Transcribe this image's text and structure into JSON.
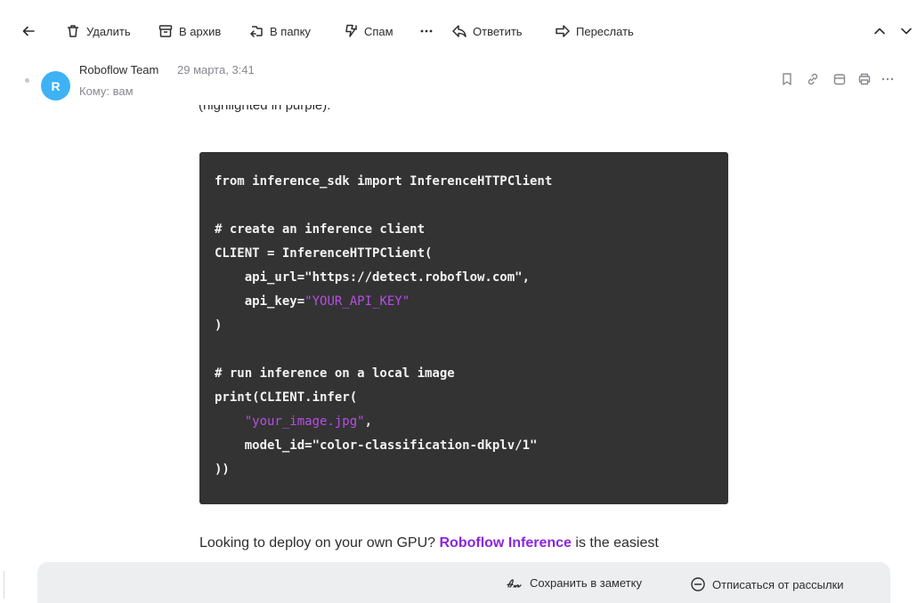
{
  "toolbar": {
    "delete": "Удалить",
    "archive": "В архив",
    "folder": "В папку",
    "spam": "Спам",
    "reply": "Ответить",
    "forward": "Переслать",
    "icons": [
      "back-arrow-icon",
      "trash-icon",
      "archive-icon",
      "folder-icon",
      "spam-icon",
      "more-icon",
      "reply-icon",
      "forward-icon",
      "chevron-up-icon",
      "chevron-down-icon"
    ]
  },
  "message": {
    "avatar_letter": "R",
    "avatar_color": "#3eb2f5",
    "sender": "Roboflow Team",
    "date": "29 марта, 3:41",
    "to": "Кому: вам",
    "header_icons": [
      "bookmark-icon",
      "link-icon",
      "calendar-icon",
      "print-icon",
      "more-icon"
    ]
  },
  "content": {
    "cut_line": "(highlighted in purple).",
    "code": {
      "l1": "from inference_sdk import InferenceHTTPClient",
      "l2": "# create an inference client",
      "l3": "CLIENT = InferenceHTTPClient(",
      "l4a": "    api_url=\"https://detect.roboflow.com\",",
      "l5a": "    api_key=",
      "l5b": "\"YOUR_API_KEY\"",
      "l6": ")",
      "l7": "# run inference on a local image",
      "l8": "print(CLIENT.infer(",
      "l9a": "    ",
      "l9b": "\"your_image.jpg\"",
      "l9c": ",",
      "l10": "    model_id=\"color-classification-dkplv/1\"",
      "l11": "))"
    },
    "body_before": "Looking to deploy on your own GPU? ",
    "body_link": "Roboflow Inference",
    "body_after": " is the easiest"
  },
  "footer": {
    "save_note": "Сохранить в заметку",
    "unsubscribe": "Отписаться от рассылки"
  },
  "colors": {
    "accent_purple": "#8a25e0",
    "code_bg": "#333333",
    "code_string": "#b74ee5"
  }
}
